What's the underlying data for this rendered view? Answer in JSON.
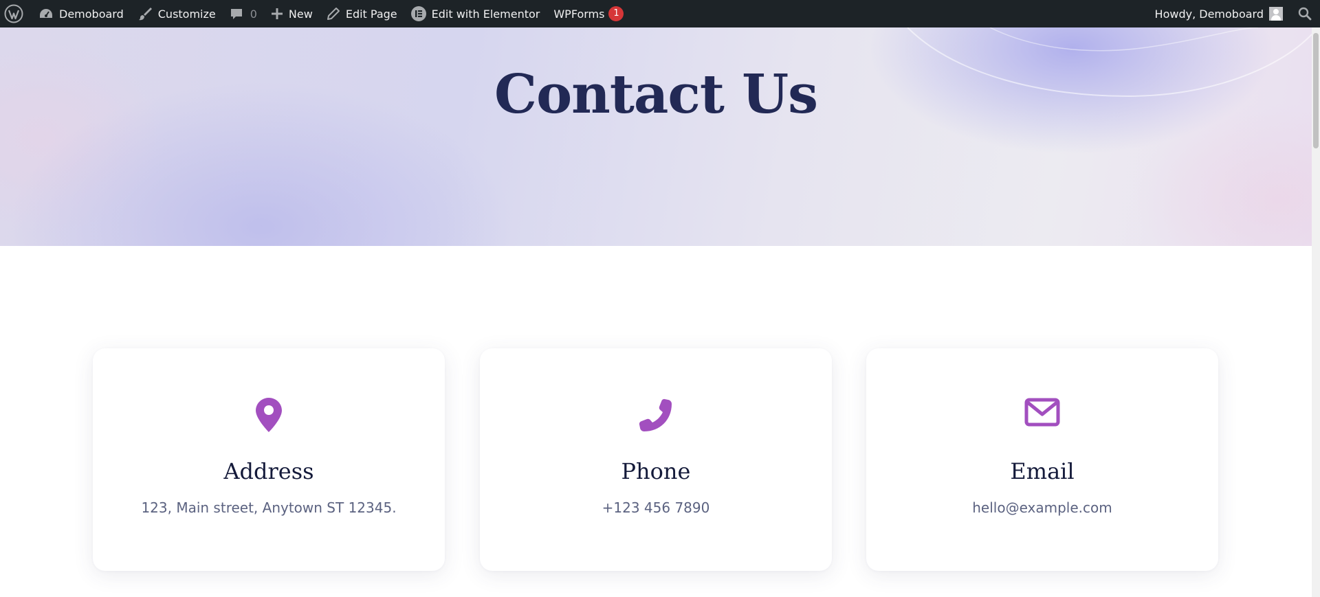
{
  "adminbar": {
    "site_name": "Demoboard",
    "customize_label": "Customize",
    "comments_count": "0",
    "new_label": "New",
    "edit_page_label": "Edit Page",
    "elementor_label": "Edit with Elementor",
    "wpforms_label": "WPForms",
    "wpforms_badge": "1",
    "howdy_label": "Howdy, Demoboard"
  },
  "hero": {
    "title": "Contact Us"
  },
  "cards": [
    {
      "icon": "map-marker-icon",
      "title": "Address",
      "text": "123, Main street, Anytown ST 12345."
    },
    {
      "icon": "phone-icon",
      "title": "Phone",
      "text": "+123 456 7890"
    },
    {
      "icon": "envelope-icon",
      "title": "Email",
      "text": "hello@example.com"
    }
  ],
  "colors": {
    "adminbar_bg": "#1d2327",
    "badge": "#d63638",
    "icon_accent": "#a24fbf",
    "heading": "#222955"
  }
}
